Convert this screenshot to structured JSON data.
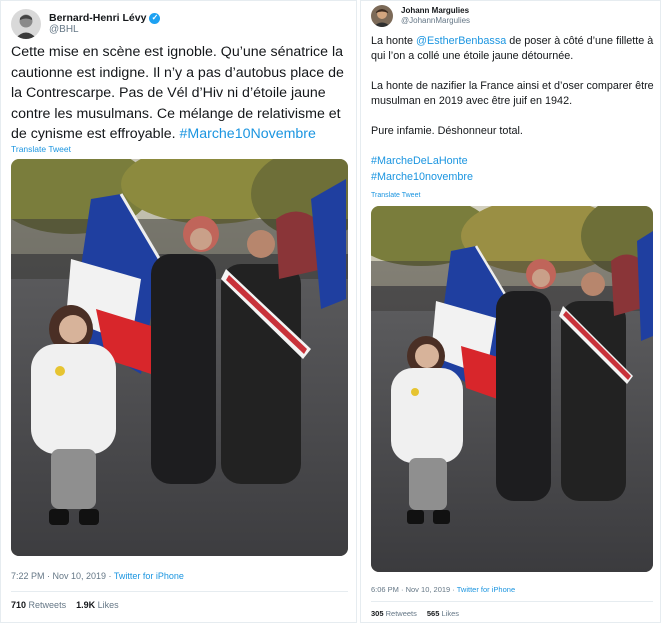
{
  "left_tweet": {
    "author_name": "Bernard-Henri Lévy",
    "author_handle": "@BHL",
    "text_main": "Cette mise en scène est ignoble. Qu’une sénatrice la cautionne est indigne. Il n’y a pas d’autobus place de la Contrescarpe. Pas de Vél d’Hiv ni d’étoile jaune contre les musulmans. Ce mélange de relativisme et de cynisme est effroyable. ",
    "hashtag": "#Marche10Novembre",
    "translate_label": "Translate Tweet",
    "timestamp": "7:22 PM · Nov 10, 2019 · ",
    "source": "Twitter for iPhone",
    "retweets_count": "710",
    "retweets_label": "Retweets",
    "likes_count": "1.9K",
    "likes_label": "Likes"
  },
  "right_tweet": {
    "author_name": "Johann Margulies",
    "author_handle": "@JohannMargulies",
    "para1_prefix": "La honte ",
    "mention": "@EstherBenbassa",
    "para1_suffix": " de poser à côté d’une fillette à qui l’on a collé une étoile jaune détournée.",
    "para2": "La honte de nazifier la France ainsi et d’oser comparer être musulman en 2019 avec être juif en 1942.",
    "para3": "Pure infamie. Déshonneur total.",
    "hashtag1": "#MarcheDeLaHonte",
    "hashtag2": "#Marche10novembre",
    "translate_label": "Translate Tweet",
    "timestamp": "6:06 PM · Nov 10, 2019 · ",
    "source": "Twitter for iPhone",
    "retweets_count": "305",
    "retweets_label": "Retweets",
    "likes_count": "565",
    "likes_label": "Likes"
  },
  "colors": {
    "link": "#1b95e0",
    "verified": "#1da1f2",
    "muted": "#657786",
    "flag_blue": "#1f3fa0",
    "flag_red": "#d8262b"
  }
}
